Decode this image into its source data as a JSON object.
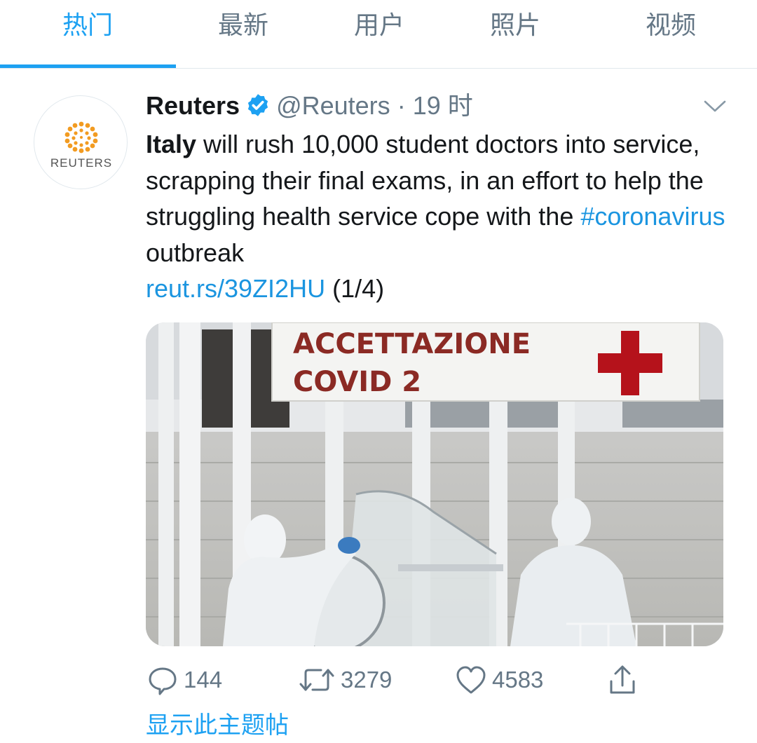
{
  "tabs": [
    {
      "label": "热门",
      "active": true
    },
    {
      "label": "最新",
      "active": false
    },
    {
      "label": "用户",
      "active": false
    },
    {
      "label": "照片",
      "active": false
    },
    {
      "label": "视频",
      "active": false
    }
  ],
  "tweet": {
    "author_name": "Reuters",
    "avatar_text": "REUTERS",
    "verified": true,
    "handle": "@Reuters",
    "separator": "·",
    "time": "19 时",
    "text_bold": "Italy",
    "text_part1": " will rush 10,000 student doctors into service, scrapping their final exams, in an effort to help the struggling health service cope with the ",
    "hashtag": "#coronavirus",
    "text_part2": " outbreak",
    "link": "reut.rs/39ZI2HU",
    "suffix": " (1/4)",
    "image": {
      "sign_line1": "ACCETTAZIONE",
      "sign_line2": "COVID 2"
    },
    "actions": {
      "replies": "144",
      "retweets": "3279",
      "likes": "4583"
    }
  },
  "show_thread_label": "显示此主题帖",
  "colors": {
    "accent": "#1da1f2",
    "link": "#1b95e0",
    "muted": "#657786",
    "red_cross": "#b5121b"
  },
  "icons": [
    "verified-badge-icon",
    "chevron-down-icon",
    "reply-icon",
    "retweet-icon",
    "like-icon",
    "share-icon"
  ]
}
